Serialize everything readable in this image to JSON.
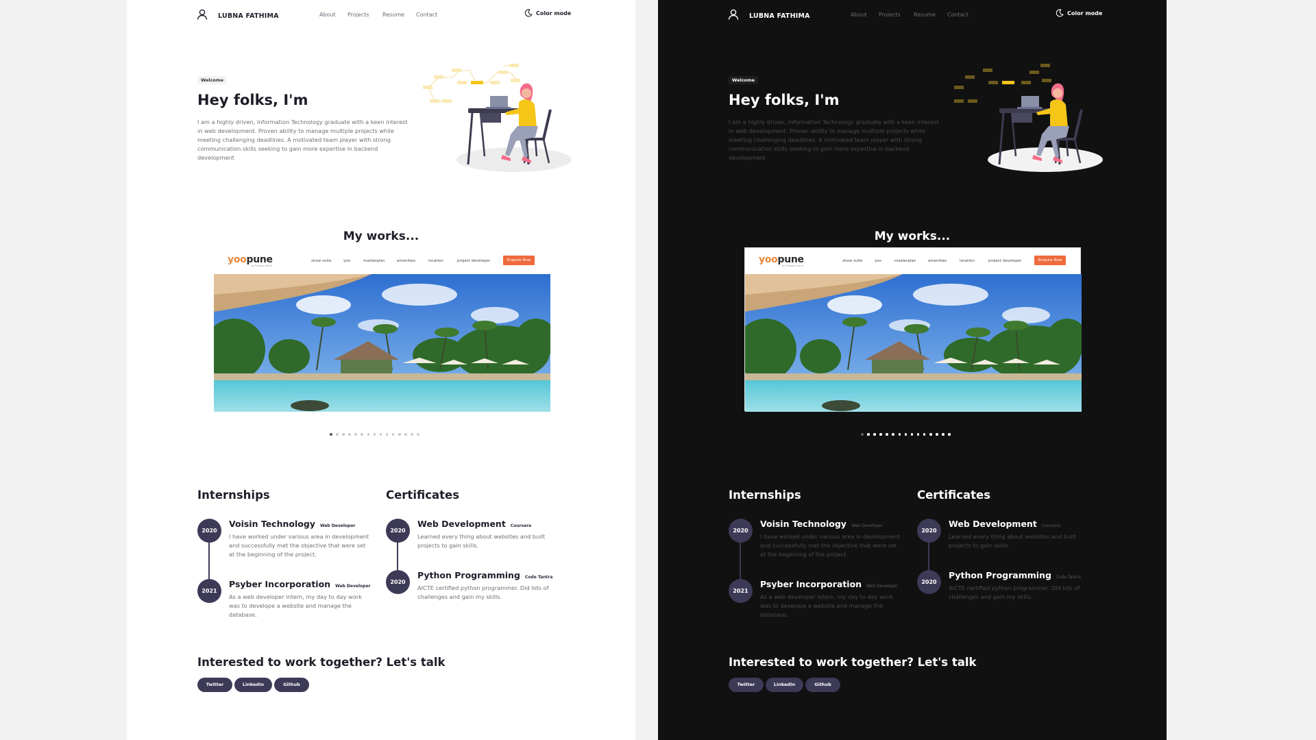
{
  "nav": {
    "brand": "LUBNA FATHIMA",
    "links": [
      "About",
      "Projects",
      "Resume",
      "Contact"
    ],
    "color_mode": "Color mode",
    "icons": [
      "user-icon",
      "moon-icon"
    ]
  },
  "hero": {
    "badge": "Welcome",
    "title": "Hey folks, I'm",
    "description": "I am a highly driven, Information Technology graduate with a keen interest in web development. Proven ability to manage multiple projects while meeting challenging deadlines. A motivated team player with strong communication skills seeking to gain more expertise in backend development"
  },
  "works": {
    "title": "My works...",
    "project": {
      "logo_a": "yoo",
      "logo_b": "pune",
      "logo_sub": "by Philippe Starck",
      "nav": [
        "show suite",
        "yoo",
        "masterplan",
        "amenities",
        "location",
        "project developer"
      ],
      "cta": "Enquire Now"
    },
    "dots_total": 15,
    "active_dot": 0
  },
  "internships": {
    "title": "Internships",
    "items": [
      {
        "year": "2020",
        "title": "Voisin Technology",
        "role": "Web Developer",
        "description": "I have worked under various area in development and successfully met the objective that were set at the beginning of the project."
      },
      {
        "year": "2021",
        "title": "Psyber Incorporation",
        "role": "Web Developer",
        "description": "As a web developer intern, my day to day work was to develope a website and manage the database."
      }
    ]
  },
  "certificates": {
    "title": "Certificates",
    "items": [
      {
        "year": "2020",
        "title": "Web Development",
        "provider": "Coursera",
        "description": "Learned every thing about websites and built projects to gain skills."
      },
      {
        "year": "2020",
        "title": "Python Programming",
        "provider": "Code Tantra",
        "description": "AICTE certified python programmer. Did lots of challenges and gain my skills."
      }
    ]
  },
  "contact": {
    "title": "Interested to work together? Let's talk",
    "links": [
      "Twitter",
      "LinkedIn",
      "Github"
    ]
  },
  "colors": {
    "light_bg": "#ffffff",
    "dark_bg": "#111111",
    "page_bg": "#f2f2f2",
    "accent": "#3c3a56",
    "highlight": "#f5c518",
    "cta": "#ef6a3c"
  }
}
